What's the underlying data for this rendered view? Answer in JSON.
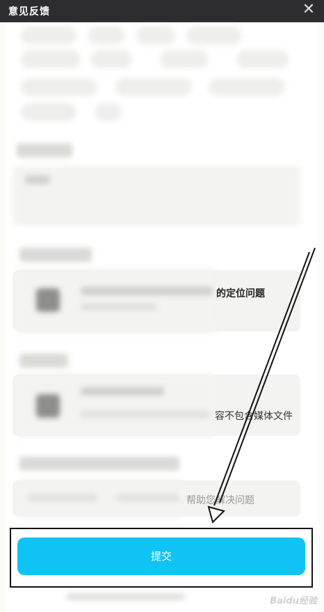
{
  "window": {
    "title": "意见反馈",
    "close_glyph": "✕"
  },
  "visible_text": {
    "location_problem": "的定位问题",
    "media_note": "容不包含媒体文件",
    "help_placeholder": "帮助您解决问题"
  },
  "submit": {
    "label": "提交"
  },
  "watermark": {
    "text": "Baidu经验"
  },
  "colors": {
    "titlebar": "#2d2d30",
    "accent": "#0fc4f5"
  }
}
